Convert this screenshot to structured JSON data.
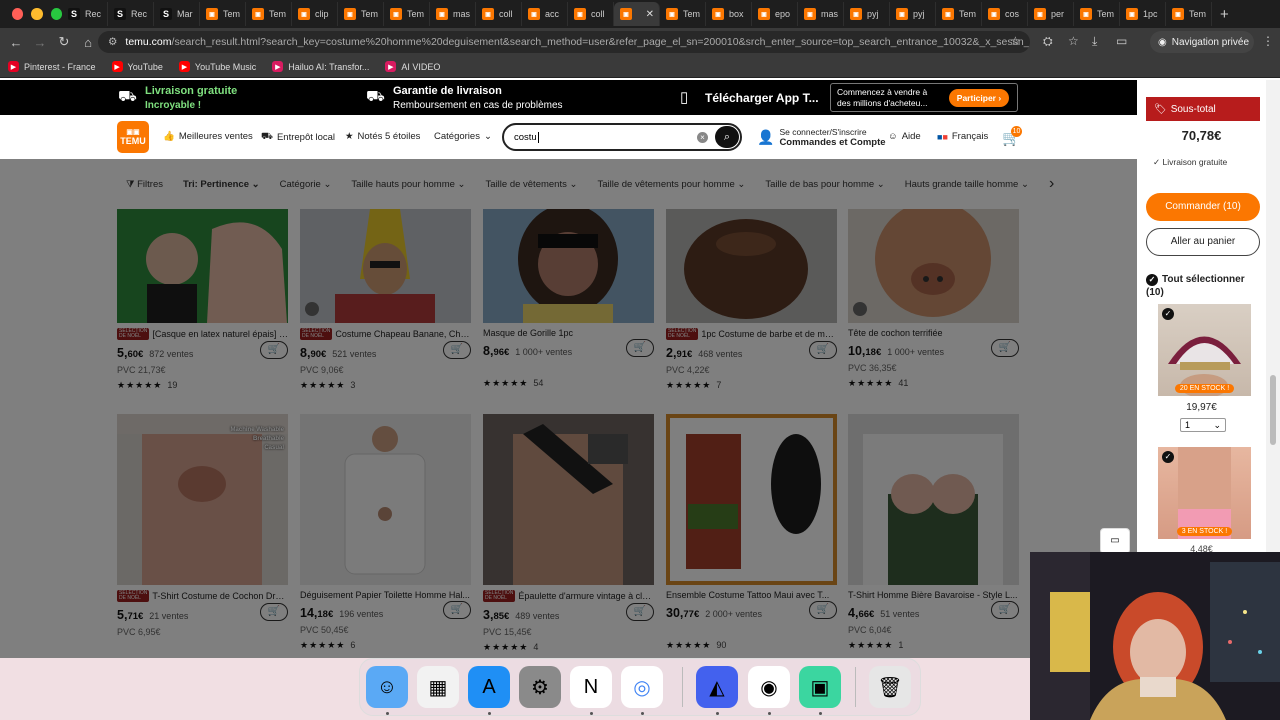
{
  "browser": {
    "tabs": [
      {
        "icon": "S",
        "label": "Rec"
      },
      {
        "icon": "S",
        "label": "Rec"
      },
      {
        "icon": "S",
        "label": "Mar"
      },
      {
        "icon": "temu",
        "label": "Tem"
      },
      {
        "icon": "temu",
        "label": "Tem"
      },
      {
        "icon": "temu",
        "label": "clip"
      },
      {
        "icon": "temu",
        "label": "Tem"
      },
      {
        "icon": "temu",
        "label": "Tem"
      },
      {
        "icon": "temu",
        "label": "mas"
      },
      {
        "icon": "temu",
        "label": "coll"
      },
      {
        "icon": "temu",
        "label": "acc"
      },
      {
        "icon": "temu",
        "label": "coll"
      },
      {
        "icon": "temu",
        "label": "",
        "active": true
      },
      {
        "icon": "temu",
        "label": "Tem"
      },
      {
        "icon": "temu",
        "label": "box"
      },
      {
        "icon": "temu",
        "label": "epo"
      },
      {
        "icon": "temu",
        "label": "mas"
      },
      {
        "icon": "temu",
        "label": "pyj"
      },
      {
        "icon": "temu",
        "label": "pyj"
      },
      {
        "icon": "temu",
        "label": "Tem"
      },
      {
        "icon": "temu",
        "label": "cos"
      },
      {
        "icon": "temu",
        "label": "per"
      },
      {
        "icon": "temu",
        "label": "Tem"
      },
      {
        "icon": "temu",
        "label": "1pc"
      },
      {
        "icon": "temu",
        "label": "Tem"
      }
    ],
    "url_domain": "temu.com",
    "url_rest": "/search_result.html?search_key=costume%20homme%20deguisement&search_method=user&refer_page_el_sn=200010&srch_enter_source=top_search_entrance_10032&_x_sessn_id...",
    "private_label": "Navigation privée",
    "bookmarks": [
      {
        "label": "Pinterest - France",
        "color": "#e60023"
      },
      {
        "label": "YouTube",
        "color": "#ff0000"
      },
      {
        "label": "YouTube Music",
        "color": "#ff0000"
      },
      {
        "label": "Hailuo AI: Transfor...",
        "color": "#d81b60"
      },
      {
        "label": "AI VIDEO",
        "color": "#d81b60"
      }
    ]
  },
  "promo": {
    "free_title": "Livraison gratuite",
    "free_sub": "Incroyable !",
    "guarantee_title": "Garantie de livraison",
    "guarantee_sub": "Remboursement en cas de problèmes",
    "app": "Télécharger App T...",
    "sell_line1": "Commencez à vendre à",
    "sell_line2": "des millions d'acheteu...",
    "sell_btn": "Participer"
  },
  "header": {
    "logo": "TEMU",
    "nav": [
      "Meilleures ventes",
      "Entrepôt local",
      "Notés 5 étoiles",
      "Catégories"
    ],
    "search_value": "costu",
    "account_line1": "Se connecter/S'inscrire",
    "account_line2": "Commandes et Compte",
    "help": "Aide",
    "lang": "Français",
    "cart_count": "10"
  },
  "filters": [
    "Filtres",
    "Tri: Pertinence",
    "Catégorie",
    "Taille hauts pour homme",
    "Taille de vêtements",
    "Taille de vêtements pour homme",
    "Taille de bas pour homme",
    "Hauts grande taille homme"
  ],
  "products": [
    {
      "title": "[Casque en latex naturel épais] C...",
      "badge": true,
      "price_int": "5,",
      "price_dec": "60€",
      "sold": "872 ventes",
      "pvc": "PVC 21,73€",
      "stars": "★★★★★",
      "reviews": "19",
      "img": "a"
    },
    {
      "title": "Costume Chapeau Banane, Chap...",
      "badge": true,
      "price_int": "8,",
      "price_dec": "90€",
      "sold": "521 ventes",
      "pvc": "PVC 9,06€",
      "stars": "★★★★★",
      "reviews": "3",
      "img": "b"
    },
    {
      "title": "Masque de Gorille 1pc",
      "badge": false,
      "price_int": "8,",
      "price_dec": "96€",
      "sold": "1 000+ ventes",
      "pvc": "",
      "stars": "★★★★★",
      "reviews": "54",
      "img": "c"
    },
    {
      "title": "1pc Costume de barbe et de mo...",
      "badge": true,
      "price_int": "2,",
      "price_dec": "91€",
      "sold": "468 ventes",
      "pvc": "PVC 4,22€",
      "stars": "★★★★★",
      "reviews": "7",
      "img": "d"
    },
    {
      "title": "Tête de cochon terrifiée",
      "badge": false,
      "price_int": "10,",
      "price_dec": "18€",
      "sold": "1 000+ ventes",
      "pvc": "PVC 36,35€",
      "stars": "★★★★★",
      "reviews": "41",
      "img": "e"
    },
    {
      "title": "T-Shirt Costume de Cochon Drôl...",
      "badge": true,
      "price_int": "5,",
      "price_dec": "71€",
      "sold": "21 ventes",
      "pvc": "PVC 6,95€",
      "stars": "",
      "reviews": "",
      "img": "f"
    },
    {
      "title": "Déguisement Papier Toilette Homme Hal...",
      "badge": false,
      "price_int": "14,",
      "price_dec": "18€",
      "sold": "196 ventes",
      "pvc": "PVC 50,45€",
      "stars": "★★★★★",
      "reviews": "6",
      "img": "g"
    },
    {
      "title": "Épaulette d'armure vintage à clo...",
      "badge": true,
      "price_int": "3,",
      "price_dec": "85€",
      "sold": "489 ventes",
      "pvc": "PVC 15,45€",
      "stars": "★★★★★",
      "reviews": "4",
      "img": "h"
    },
    {
      "title": "Ensemble Costume Tattoo Maui avec T...",
      "badge": false,
      "price_int": "30,",
      "price_dec": "77€",
      "sold": "2 000+ ventes",
      "pvc": "",
      "stars": "★★★★★",
      "reviews": "90",
      "img": "i"
    },
    {
      "title": "T-Shirt Homme Bière Bavaroise - Style L...",
      "badge": false,
      "price_int": "4,",
      "price_dec": "66€",
      "sold": "51 ventes",
      "pvc": "PVC 6,04€",
      "stars": "★★★★★",
      "reviews": "1",
      "img": "j"
    }
  ],
  "pig_shirt_text": "Machine Washable\nBreathable\nCasual",
  "sidebar": {
    "subtotal_label": "Sous-total",
    "price": "70,78€",
    "free_ship": "Livraison gratuite",
    "order_btn": "Commander (10)",
    "goto_cart": "Aller au panier",
    "select_all": "Tout sélectionner",
    "select_count": "(10)",
    "item1_stock": "20 EN STOCK !",
    "item1_price": "19,97€",
    "item1_qty": "1",
    "item2_stock": "3 EN STOCK !",
    "item2_price": "4,48€"
  },
  "dock": [
    "finder-icon",
    "launchpad-icon",
    "app-store-icon",
    "system-settings-icon",
    "notion-icon",
    "chrome-icon",
    "nordvpn-icon",
    "obs-icon",
    "streamlabs-icon",
    "trash-icon"
  ]
}
